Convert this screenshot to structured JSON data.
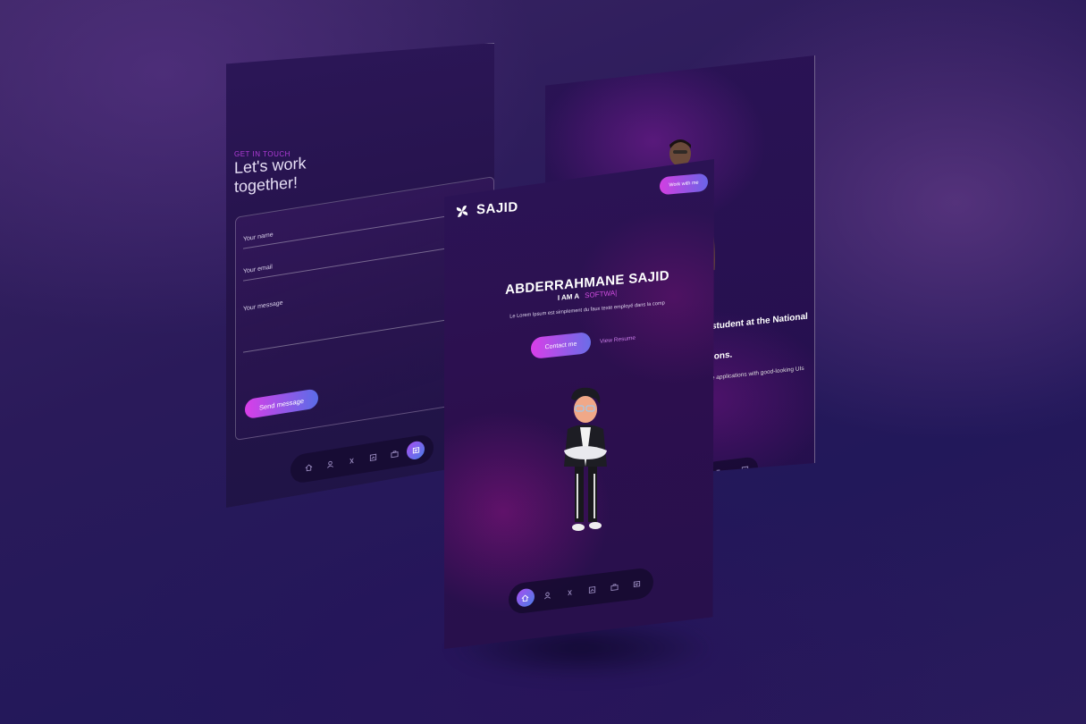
{
  "left_panel": {
    "eyebrow": "GET IN TOUCH",
    "heading": "Let's work\ntogether!",
    "form": {
      "name_placeholder": "Your name",
      "email_placeholder": "Your email",
      "message_placeholder": "Your message",
      "submit_label": "Send message"
    }
  },
  "center_panel": {
    "brand": "SAJID",
    "cta_label": "Work with me",
    "name": "ABDERRAHMANE SAJID",
    "role_prefix": "I AM A",
    "role_typed": "SOFTWA|",
    "lead": "Le Lorem Ipsum est simplement du faux texte employé dans la comp",
    "contact_label": "Contact me",
    "resume_label": "View Resume"
  },
  "right_panel": {
    "about_title": "student at the National\nions.",
    "about_text": "e.\nile applications with good-looking UIs"
  },
  "nav": {
    "icons": [
      "home-icon",
      "user-icon",
      "code-icon",
      "chart-icon",
      "briefcase-icon",
      "message-icon"
    ],
    "active_center": "home-icon",
    "active_left": "message-icon"
  },
  "colors": {
    "accent_pink": "#d93ee8",
    "accent_blue": "#5a6de8",
    "background": "#2a1a5a"
  }
}
